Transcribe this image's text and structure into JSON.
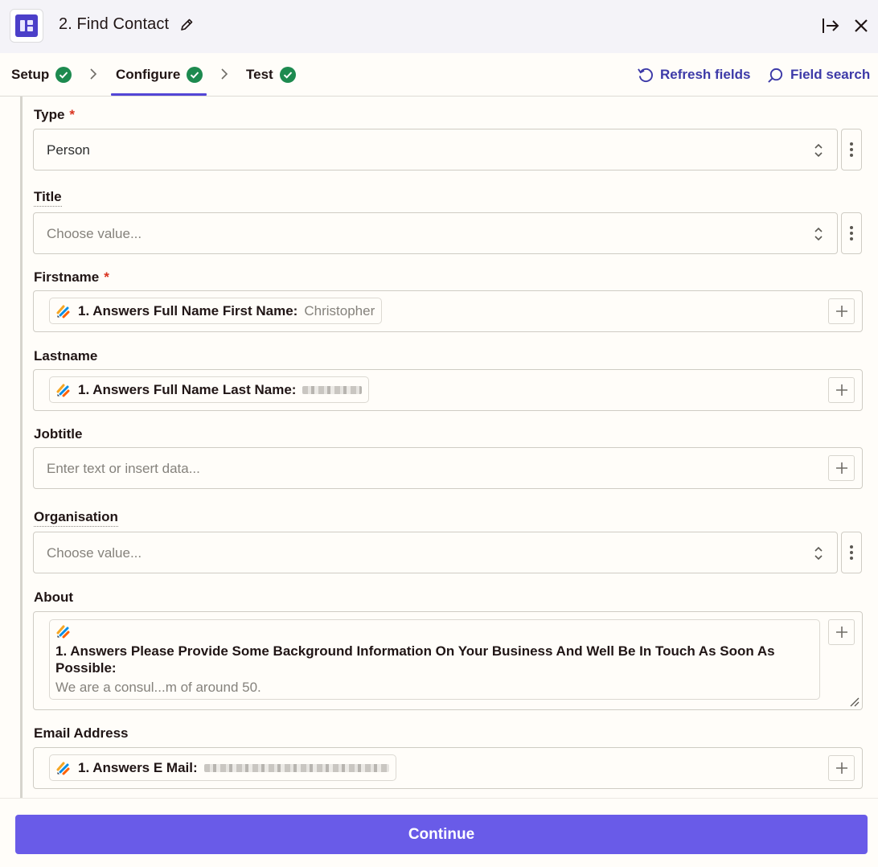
{
  "header": {
    "title": "2. Find Contact",
    "app_icon": "copper-app-icon"
  },
  "tabs": [
    {
      "label": "Setup",
      "status": "complete"
    },
    {
      "label": "Configure",
      "status": "complete",
      "active": true
    },
    {
      "label": "Test",
      "status": "complete"
    }
  ],
  "toolbar": {
    "refresh_label": "Refresh fields",
    "search_label": "Field search"
  },
  "fields": {
    "type": {
      "label": "Type",
      "required": "*",
      "value": "Person"
    },
    "title": {
      "label": "Title",
      "placeholder": "Choose value..."
    },
    "firstname": {
      "label": "Firstname",
      "required": "*",
      "pill_label": "1. Answers Full Name First Name:",
      "pill_value": "Christopher"
    },
    "lastname": {
      "label": "Lastname",
      "pill_label": "1. Answers Full Name Last Name:"
    },
    "jobtitle": {
      "label": "Jobtitle",
      "placeholder": "Enter text or insert data..."
    },
    "organisation": {
      "label": "Organisation",
      "placeholder": "Choose value..."
    },
    "about": {
      "label": "About",
      "pill_label": "1. Answers Please Provide Some Background Information On Your Business And Well Be In Touch As Soon As Possible:",
      "pill_value": "We are a consul...m of around 50."
    },
    "email": {
      "label": "Email Address",
      "pill_label": "1. Answers E Mail:"
    }
  },
  "footer": {
    "continue_label": "Continue"
  },
  "colors": {
    "accent": "#695be8",
    "check": "#1d8a4f",
    "required": "#d9331f",
    "link": "#3d3aa8"
  }
}
